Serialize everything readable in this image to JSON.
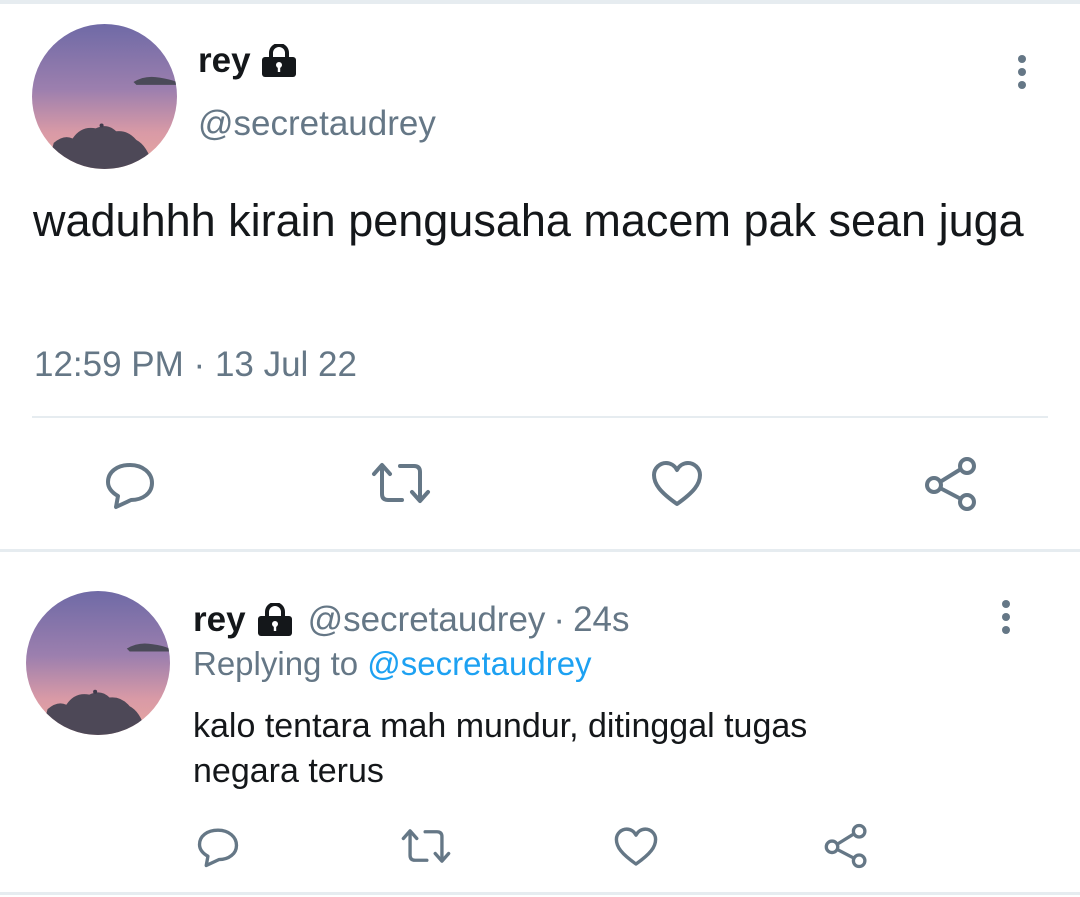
{
  "main_tweet": {
    "name": "rey",
    "handle": "@secretaudrey",
    "text": "waduhhh kirain pengusaha macem pak sean juga",
    "time": "12:59 PM",
    "separator": "·",
    "date": "13 Jul 22",
    "icons": {
      "lock": "lock-icon",
      "more": "more-vertical-icon",
      "reply": "reply-icon",
      "retweet": "retweet-icon",
      "like": "heart-icon",
      "share": "share-icon"
    }
  },
  "reply_tweet": {
    "name": "rey",
    "handle": "@secretaudrey",
    "separator": "·",
    "age": "24s",
    "replying_prefix": "Replying to",
    "replying_handle": "@secretaudrey",
    "text": "kalo tentara mah mundur, ditinggal tugas negara terus"
  },
  "colors": {
    "primary_text": "#14171a",
    "secondary_text": "#657786",
    "link": "#1da1f2",
    "divider": "#e6ecf0"
  }
}
